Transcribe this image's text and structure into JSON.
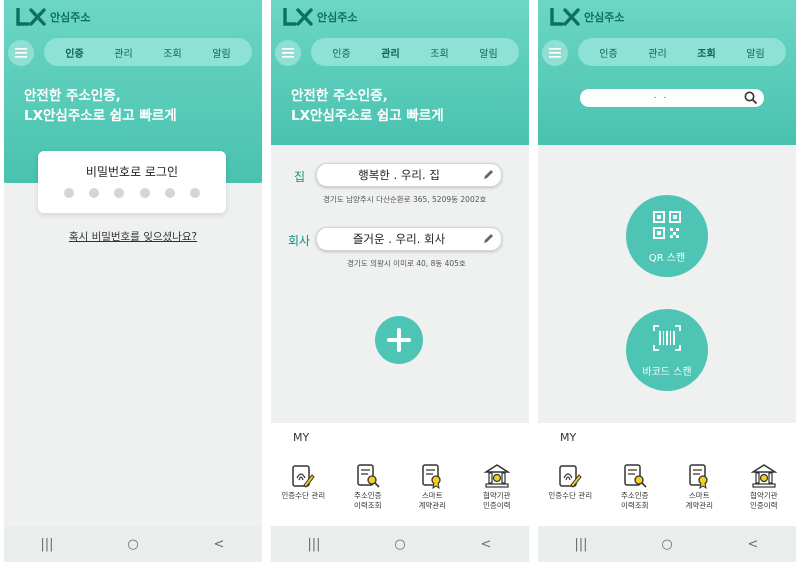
{
  "brand": {
    "logo_letters": "LX",
    "name": "안심주소"
  },
  "tabs": [
    "인증",
    "관리",
    "조회",
    "알림"
  ],
  "headline": {
    "line1": "안전한 주소인증,",
    "line2": "LX안심주소로 쉽고 빠르게"
  },
  "screen1": {
    "login_title": "비밀번호로 로그인",
    "pin_dots": 6,
    "forgot_link": "혹시 비밀번호를 잊으셨나요?"
  },
  "screen2": {
    "addresses": [
      {
        "label": "집",
        "name": "행복한 . 우리. 집",
        "detail": "경기도 남양주시 다산순환로 365, 5209동 2002호"
      },
      {
        "label": "회사",
        "name": "즐거운 . 우리. 회사",
        "detail": "경기도 의왕시 이미로 40, 8동 405호"
      }
    ]
  },
  "screen3": {
    "search_text": ". .",
    "qr_label": "QR 스캔",
    "barcode_label": "바코드 스캔"
  },
  "my": {
    "title": "MY",
    "items": [
      {
        "label": "인증수단 관리",
        "icon": "fingerprint-doc-icon"
      },
      {
        "label": "주소인증\n이력조회",
        "icon": "doc-search-icon"
      },
      {
        "label": "스마트\n계약관리",
        "icon": "contract-icon"
      },
      {
        "label": "협약기관\n인증이력",
        "icon": "institution-icon"
      }
    ]
  },
  "nav": {
    "recents": "|||",
    "home": "○",
    "back": "<"
  },
  "colors": {
    "primary": "#4ec5b4",
    "header_top": "#6cd6c4",
    "dark_teal": "#0e6f63",
    "icon_yellow": "#f5d020"
  }
}
